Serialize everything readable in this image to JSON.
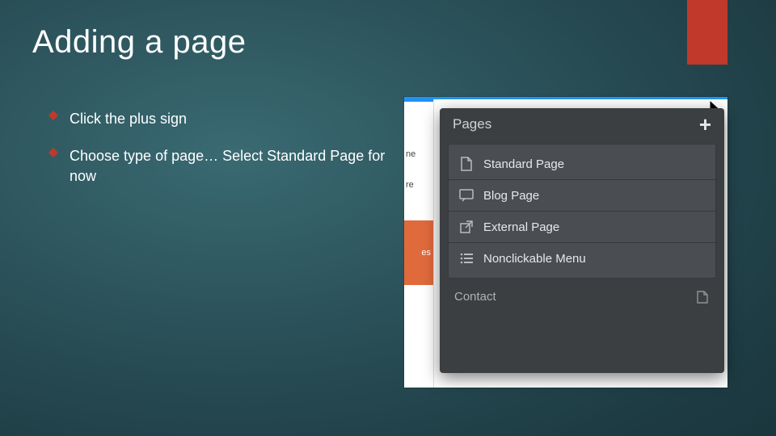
{
  "title": "Adding a page",
  "bullets": [
    "Click the plus sign",
    "Choose type of page… Select Standard Page for now"
  ],
  "accent_color": "#c0392b",
  "inset": {
    "panel_title": "Pages",
    "plus_label": "+",
    "menu": [
      "Standard Page",
      "Blog Page",
      "External Page",
      "Nonclickable Menu"
    ],
    "footer_label": "Contact",
    "left_fragments": {
      "a": "ne",
      "b": "re",
      "c": "es"
    }
  }
}
